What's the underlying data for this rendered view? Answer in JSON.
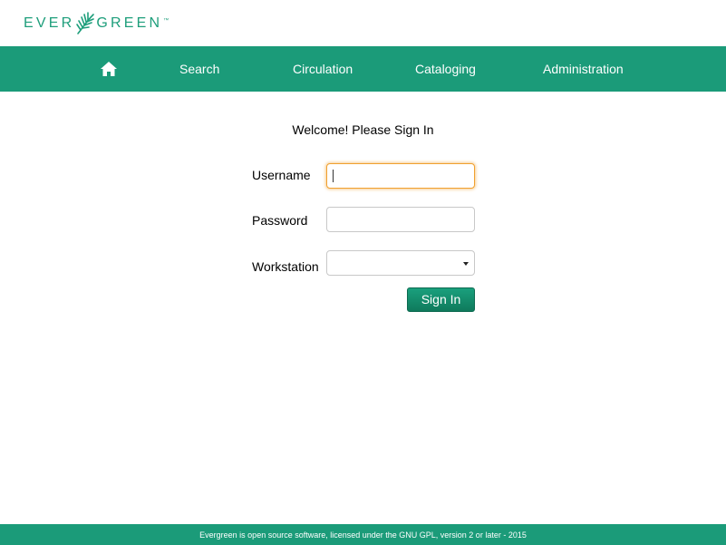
{
  "logo": {
    "text_before": "EVER",
    "text_after": "GREEN",
    "trademark": "™",
    "brand_color": "#1e9e7b"
  },
  "navbar": {
    "background": "#1b9b79",
    "home_icon": "home-icon",
    "items": [
      {
        "label": "Search"
      },
      {
        "label": "Circulation"
      },
      {
        "label": "Cataloging"
      },
      {
        "label": "Administration"
      }
    ]
  },
  "login": {
    "heading": "Welcome! Please Sign In",
    "username_label": "Username",
    "username_value": "",
    "password_label": "Password",
    "password_value": "",
    "workstation_label": "Workstation",
    "workstation_value": "",
    "submit_label": "Sign In",
    "focus_color": "#f0a030"
  },
  "footer": {
    "text": "Evergreen is open source software, licensed under the GNU GPL, version 2 or later - 2015"
  }
}
